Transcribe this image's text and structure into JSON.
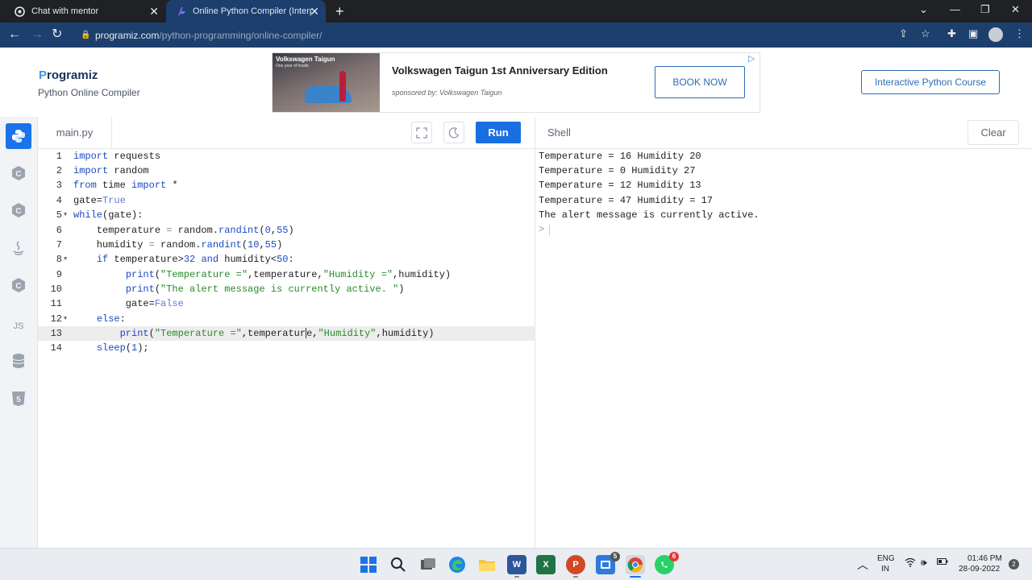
{
  "browser": {
    "tabs": [
      {
        "title": "Chat with mentor",
        "icon": "chatgpt-icon"
      },
      {
        "title": "Online Python Compiler (Interpre",
        "icon": "programiz-icon"
      }
    ],
    "url_host": "programiz.com",
    "url_path": "/python-programming/online-compiler/"
  },
  "header": {
    "logo": "rogramiz",
    "logo_prefix": "P",
    "subtitle": "Python Online Compiler",
    "course_button": "Interactive Python Course"
  },
  "ad": {
    "image_title": "Volkswagen Taigun",
    "image_subtitle": "One year of hustle",
    "headline": "Volkswagen Taigun 1st Anniversary Edition",
    "sponsor": "sponsored by: Volkswagen Taigun",
    "button": "BOOK NOW"
  },
  "sidebar": {
    "items": [
      {
        "icon": "python-icon"
      },
      {
        "icon": "c-icon"
      },
      {
        "icon": "cpp-icon"
      },
      {
        "icon": "java-icon"
      },
      {
        "icon": "csharp-icon"
      },
      {
        "label": "JS",
        "icon": "javascript-icon"
      },
      {
        "icon": "database-icon"
      },
      {
        "icon": "html5-icon"
      }
    ]
  },
  "editor": {
    "filename": "main.py",
    "run_label": "Run",
    "line_numbers": [
      "1",
      "2",
      "3",
      "4",
      "5",
      "6",
      "7",
      "8",
      "9",
      "10",
      "11",
      "12",
      "13",
      "14"
    ]
  },
  "shell": {
    "title": "Shell",
    "clear_label": "Clear",
    "output": [
      "Temperature = 16 Humidity 20",
      "Temperature = 0 Humidity 27",
      "Temperature = 12 Humidity 13",
      "Temperature = 47 Humidity = 17",
      "The alert message is currently active."
    ],
    "prompt": ">"
  },
  "taskbar": {
    "teams_badge": "5",
    "whatsapp_badge": "6",
    "lang": "ENG",
    "region": "IN",
    "time": "01:46 PM",
    "date": "28-09-2022",
    "notifications": "2"
  }
}
